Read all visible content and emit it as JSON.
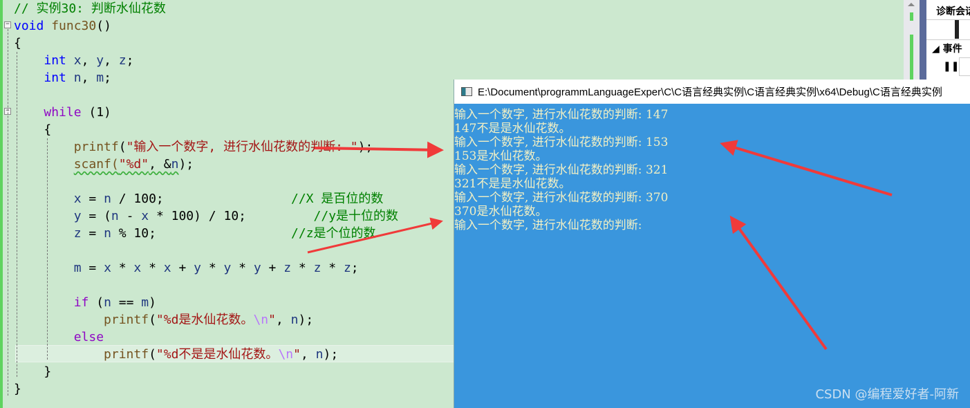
{
  "editor": {
    "lines": [
      {
        "row": 0,
        "tokens": [
          {
            "t": "// 实例30: 判断水仙花数",
            "c": "cm"
          }
        ]
      },
      {
        "row": 1,
        "tokens": [
          {
            "t": "void",
            "c": "kw"
          },
          {
            "t": " "
          },
          {
            "t": "func30",
            "c": "fn"
          },
          {
            "t": "()"
          }
        ]
      },
      {
        "row": 2,
        "tokens": [
          {
            "t": "{"
          }
        ]
      },
      {
        "row": 3,
        "tokens": [
          {
            "t": "    "
          },
          {
            "t": "int",
            "c": "kw"
          },
          {
            "t": " "
          },
          {
            "t": "x",
            "c": "var"
          },
          {
            "t": ", "
          },
          {
            "t": "y",
            "c": "var"
          },
          {
            "t": ", "
          },
          {
            "t": "z",
            "c": "var"
          },
          {
            "t": ";"
          }
        ]
      },
      {
        "row": 4,
        "tokens": [
          {
            "t": "    "
          },
          {
            "t": "int",
            "c": "kw"
          },
          {
            "t": " "
          },
          {
            "t": "n",
            "c": "var"
          },
          {
            "t": ", "
          },
          {
            "t": "m",
            "c": "var"
          },
          {
            "t": ";"
          }
        ]
      },
      {
        "row": 6,
        "tokens": [
          {
            "t": "    "
          },
          {
            "t": "while",
            "c": "ctl"
          },
          {
            "t": " (1)"
          }
        ]
      },
      {
        "row": 7,
        "tokens": [
          {
            "t": "    {"
          }
        ]
      },
      {
        "row": 8,
        "tokens": [
          {
            "t": "        "
          },
          {
            "t": "printf",
            "c": "fn"
          },
          {
            "t": "("
          },
          {
            "t": "\"输入一个数字, 进行水仙花数的判断: \"",
            "c": "str"
          },
          {
            "t": ");"
          }
        ]
      },
      {
        "row": 9,
        "tokens": [
          {
            "t": "        "
          },
          {
            "t": "scanf(",
            "c": "fn squig"
          },
          {
            "t": "\"%d\"",
            "c": "str squig"
          },
          {
            "t": ", &",
            "c": "squig"
          },
          {
            "t": "n",
            "c": "var squig"
          },
          {
            "t": ");"
          }
        ]
      },
      {
        "row": 11,
        "tokens": [
          {
            "t": "        "
          },
          {
            "t": "x",
            "c": "var"
          },
          {
            "t": " = "
          },
          {
            "t": "n",
            "c": "var"
          },
          {
            "t": " / 100;"
          },
          {
            "t": "                 "
          },
          {
            "t": "//X 是百位的数",
            "c": "cm"
          }
        ]
      },
      {
        "row": 12,
        "tokens": [
          {
            "t": "        "
          },
          {
            "t": "y",
            "c": "var"
          },
          {
            "t": " = ("
          },
          {
            "t": "n",
            "c": "var"
          },
          {
            "t": " - "
          },
          {
            "t": "x",
            "c": "var"
          },
          {
            "t": " * 100) / 10;"
          },
          {
            "t": "         "
          },
          {
            "t": "//y是十位的数",
            "c": "cm"
          }
        ]
      },
      {
        "row": 13,
        "tokens": [
          {
            "t": "        "
          },
          {
            "t": "z",
            "c": "var"
          },
          {
            "t": " = "
          },
          {
            "t": "n",
            "c": "var"
          },
          {
            "t": " % 10;"
          },
          {
            "t": "                  "
          },
          {
            "t": "//z是个位的数",
            "c": "cm"
          }
        ]
      },
      {
        "row": 15,
        "tokens": [
          {
            "t": "        "
          },
          {
            "t": "m",
            "c": "var"
          },
          {
            "t": " = "
          },
          {
            "t": "x",
            "c": "var"
          },
          {
            "t": " * "
          },
          {
            "t": "x",
            "c": "var"
          },
          {
            "t": " * "
          },
          {
            "t": "x",
            "c": "var"
          },
          {
            "t": " + "
          },
          {
            "t": "y",
            "c": "var"
          },
          {
            "t": " * "
          },
          {
            "t": "y",
            "c": "var"
          },
          {
            "t": " * "
          },
          {
            "t": "y",
            "c": "var"
          },
          {
            "t": " + "
          },
          {
            "t": "z",
            "c": "var"
          },
          {
            "t": " * "
          },
          {
            "t": "z",
            "c": "var"
          },
          {
            "t": " * "
          },
          {
            "t": "z",
            "c": "var"
          },
          {
            "t": ";"
          }
        ]
      },
      {
        "row": 17,
        "tokens": [
          {
            "t": "        "
          },
          {
            "t": "if",
            "c": "ctl"
          },
          {
            "t": " ("
          },
          {
            "t": "n",
            "c": "var"
          },
          {
            "t": " == "
          },
          {
            "t": "m",
            "c": "var"
          },
          {
            "t": ")"
          }
        ]
      },
      {
        "row": 18,
        "tokens": [
          {
            "t": "            "
          },
          {
            "t": "printf",
            "c": "fn"
          },
          {
            "t": "("
          },
          {
            "t": "\"%d是水仙花数。",
            "c": "str"
          },
          {
            "t": "\\n",
            "c": "esc"
          },
          {
            "t": "\"",
            "c": "str"
          },
          {
            "t": ", "
          },
          {
            "t": "n",
            "c": "var"
          },
          {
            "t": ");"
          }
        ]
      },
      {
        "row": 19,
        "tokens": [
          {
            "t": "        "
          },
          {
            "t": "else",
            "c": "ctl"
          }
        ]
      },
      {
        "row": 20,
        "tokens": [
          {
            "t": "            "
          },
          {
            "t": "printf",
            "c": "fn"
          },
          {
            "t": "("
          },
          {
            "t": "\"%d不是是水仙花数。",
            "c": "str"
          },
          {
            "t": "\\n",
            "c": "esc"
          },
          {
            "t": "\"",
            "c": "str"
          },
          {
            "t": ", "
          },
          {
            "t": "n",
            "c": "var"
          },
          {
            "t": ");"
          }
        ]
      },
      {
        "row": 21,
        "tokens": [
          {
            "t": "    }"
          }
        ]
      },
      {
        "row": 22,
        "tokens": [
          {
            "t": "}"
          }
        ]
      }
    ]
  },
  "diagnostics": {
    "title": "诊断会话",
    "events": "事件",
    "pause_icon": "pause-icon"
  },
  "console": {
    "title": "E:\\Document\\programmLanguageExper\\C\\C语言经典实例\\C语言经典实例\\x64\\Debug\\C语言经典实例",
    "background": "#3a96dd",
    "lines": [
      "输入一个数字, 进行水仙花数的判断: 147",
      "147不是是水仙花数。",
      "输入一个数字, 进行水仙花数的判断: 153",
      "153是水仙花数。",
      "输入一个数字, 进行水仙花数的判断: 321",
      "321不是是水仙花数。",
      "输入一个数字, 进行水仙花数的判断: 370",
      "370是水仙花数。",
      "输入一个数字, 进行水仙花数的判断: "
    ]
  },
  "watermark": "CSDN @编程爱好者-阿新",
  "annotation_color": "#f03a3a"
}
